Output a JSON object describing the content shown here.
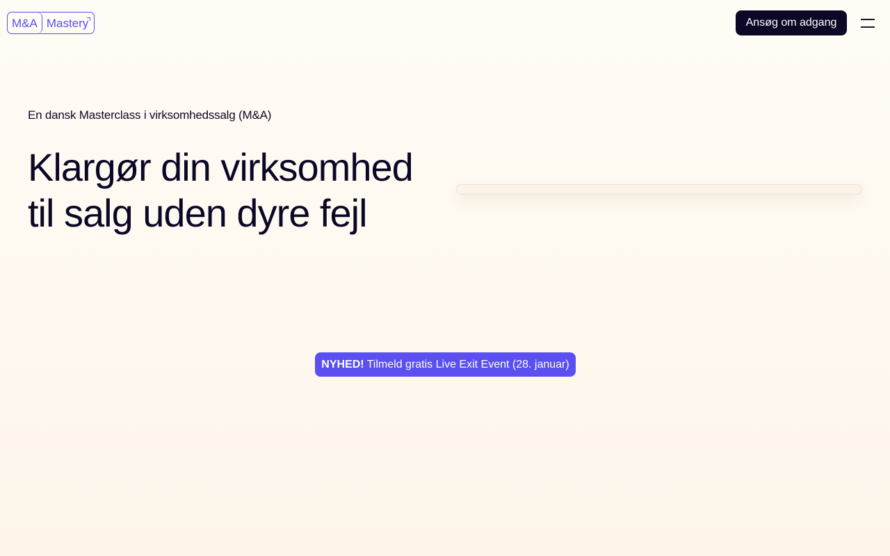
{
  "header": {
    "logo_left": "M&A",
    "logo_right": "Mastery",
    "cta_label": "Ansøg om adgang",
    "menu_icon": "hamburger-icon"
  },
  "hero": {
    "eyebrow": "En dansk Masterclass i virksomhedssalg (M&A)",
    "headline_line1": "Klargør din virksomhed",
    "headline_line2": "til salg uden dyre fejl"
  },
  "banner": {
    "tag": "NYHED!",
    "text": "Tilmeld gratis Live Exit Event (28. januar)"
  },
  "colors": {
    "accent": "#5a4ff0",
    "dark": "#0d0726",
    "background": "#fdf7ee"
  }
}
